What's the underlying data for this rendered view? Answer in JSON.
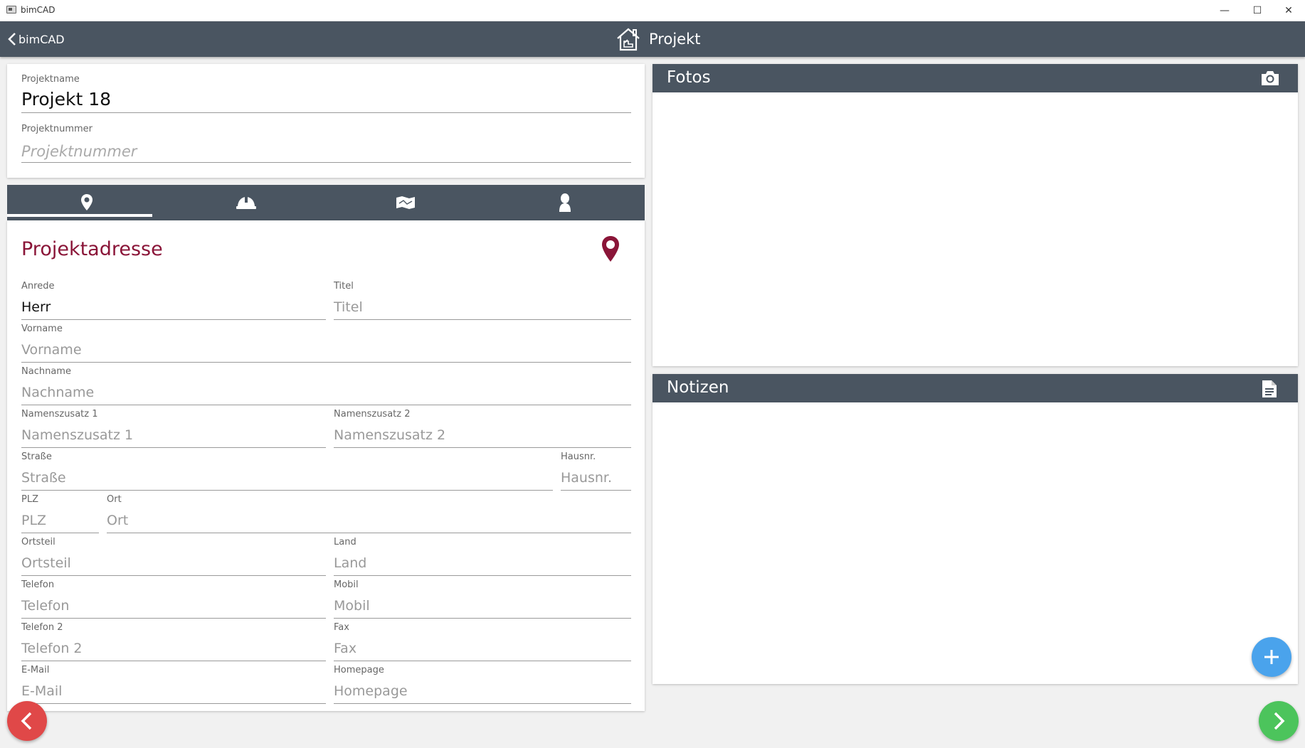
{
  "window": {
    "title": "bimCAD",
    "minimize_glyph": "—",
    "maximize_glyph": "☐",
    "close_glyph": "✕"
  },
  "appbar": {
    "back_label": "bimCAD",
    "title": "Projekt"
  },
  "project": {
    "name_label": "Projektname",
    "name_value": "Projekt 18",
    "number_label": "Projektnummer",
    "number_placeholder": "Projektnummer"
  },
  "tabs": [
    {
      "icon": "location-pin-icon",
      "selected": true
    },
    {
      "icon": "hard-hat-icon",
      "selected": false
    },
    {
      "icon": "map-icon",
      "selected": false
    },
    {
      "icon": "person-icon",
      "selected": false
    }
  ],
  "address": {
    "title": "Projektadresse",
    "fields": {
      "anrede": {
        "label": "Anrede",
        "value": "Herr"
      },
      "titel": {
        "label": "Titel",
        "placeholder": "Titel"
      },
      "vorname": {
        "label": "Vorname",
        "placeholder": "Vorname"
      },
      "nachname": {
        "label": "Nachname",
        "placeholder": "Nachname"
      },
      "namenszusatz1": {
        "label": "Namenszusatz 1",
        "placeholder": "Namenszusatz 1"
      },
      "namenszusatz2": {
        "label": "Namenszusatz 2",
        "placeholder": "Namenszusatz 2"
      },
      "strasse": {
        "label": "Straße",
        "placeholder": "Straße"
      },
      "hausnr": {
        "label": "Hausnr.",
        "placeholder": "Hausnr."
      },
      "plz": {
        "label": "PLZ",
        "placeholder": "PLZ"
      },
      "ort": {
        "label": "Ort",
        "placeholder": "Ort"
      },
      "ortsteil": {
        "label": "Ortsteil",
        "placeholder": "Ortsteil"
      },
      "land": {
        "label": "Land",
        "placeholder": "Land"
      },
      "telefon": {
        "label": "Telefon",
        "placeholder": "Telefon"
      },
      "mobil": {
        "label": "Mobil",
        "placeholder": "Mobil"
      },
      "telefon2": {
        "label": "Telefon 2",
        "placeholder": "Telefon 2"
      },
      "fax": {
        "label": "Fax",
        "placeholder": "Fax"
      },
      "email": {
        "label": "E-Mail",
        "placeholder": "E-Mail"
      },
      "homepage": {
        "label": "Homepage",
        "placeholder": "Homepage"
      }
    }
  },
  "fotos": {
    "title": "Fotos",
    "icon": "camera-icon"
  },
  "notizen": {
    "title": "Notizen",
    "icon": "document-icon"
  },
  "colors": {
    "header": "#4a5561",
    "accent": "#8a1538",
    "fab_add": "#4aa3ec",
    "fab_back": "#e04848",
    "fab_next": "#4cc45c"
  }
}
